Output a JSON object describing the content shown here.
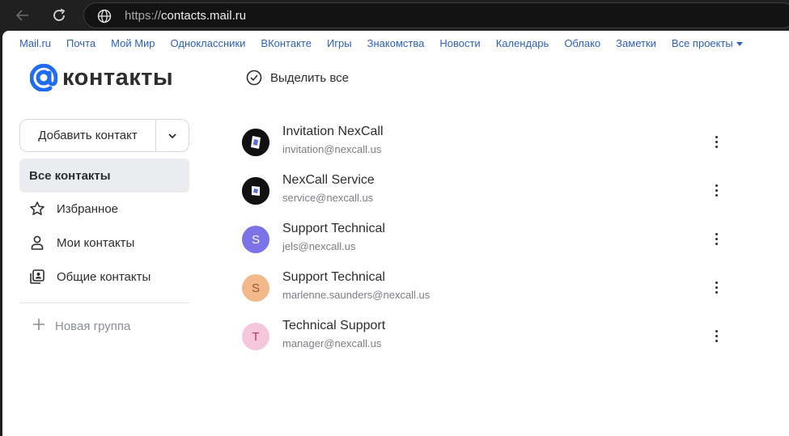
{
  "browser": {
    "url_prefix": "https://",
    "url_host": "contacts.mail.ru"
  },
  "topnav": {
    "items": [
      "Mail.ru",
      "Почта",
      "Мой Мир",
      "Одноклассники",
      "ВКонтакте",
      "Игры",
      "Знакомства",
      "Новости",
      "Календарь",
      "Облако",
      "Заметки",
      "Все проекты"
    ]
  },
  "logo": {
    "text": "контакты"
  },
  "toolbar": {
    "select_all": "Выделить все"
  },
  "sidebar": {
    "add_contact": "Добавить контакт",
    "items": [
      {
        "label": "Все контакты",
        "icon": "none"
      },
      {
        "label": "Избранное",
        "icon": "star-icon"
      },
      {
        "label": "Мои контакты",
        "icon": "person-icon"
      },
      {
        "label": "Общие контакты",
        "icon": "shared-contacts-icon"
      }
    ],
    "new_group": "Новая группа"
  },
  "contacts": [
    {
      "name": "Invitation NexCall",
      "email": "invitation@nexcall.us",
      "avatar_letter": "",
      "avatar_color": "#111111"
    },
    {
      "name": "NexCall Service",
      "email": "service@nexcall.us",
      "avatar_letter": "",
      "avatar_color": "#111111"
    },
    {
      "name": "Support Technical",
      "email": "jels@nexcall.us",
      "avatar_letter": "S",
      "avatar_color": "#7b73e8"
    },
    {
      "name": "Support Technical",
      "email": "marlenne.saunders@nexcall.us",
      "avatar_letter": "S",
      "avatar_color": "#f2b98a"
    },
    {
      "name": "Technical Support",
      "email": "manager@nexcall.us",
      "avatar_letter": "T",
      "avatar_color": "#f6c6dd"
    }
  ],
  "colors": {
    "link": "#2e5fbd",
    "logo_blue": "#1f6cf0",
    "text": "#2c2d2e",
    "muted": "#7a7d82"
  }
}
